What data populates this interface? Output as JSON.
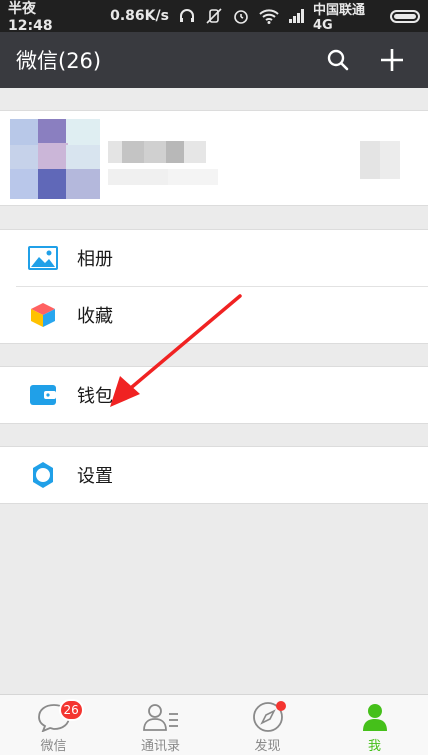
{
  "status_bar": {
    "time": "半夜12:48",
    "speed": "0.86K/s",
    "carrier": "中国联通4G"
  },
  "header": {
    "title": "微信(26)",
    "search_icon": "search-icon",
    "add_icon": "plus-icon"
  },
  "menu": {
    "group1": [
      {
        "label": "相册",
        "icon": "album-icon"
      },
      {
        "label": "收藏",
        "icon": "favorites-icon"
      }
    ],
    "group2": [
      {
        "label": "钱包",
        "icon": "wallet-icon"
      }
    ],
    "group3": [
      {
        "label": "设置",
        "icon": "gear-icon"
      }
    ]
  },
  "tabbar": {
    "tabs": [
      {
        "label": "微信",
        "icon": "chat-icon",
        "badge": "26"
      },
      {
        "label": "通讯录",
        "icon": "contacts-icon"
      },
      {
        "label": "发现",
        "icon": "compass-icon"
      },
      {
        "label": "我",
        "icon": "person-icon"
      }
    ]
  },
  "colors": {
    "nav_bg": "#393a3f",
    "accent_green": "#45c01a",
    "badge_red": "#f43530",
    "icon_blue": "#20a0e8"
  }
}
